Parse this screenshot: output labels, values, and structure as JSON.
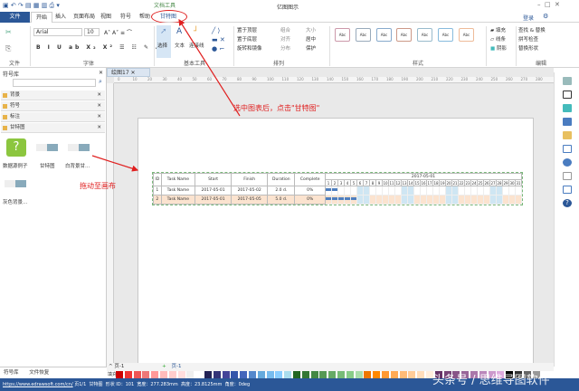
{
  "window": {
    "title": "亿图图示",
    "context_tab_group": "文档工具"
  },
  "tabs": [
    {
      "label": "文件"
    },
    {
      "label": "开始"
    },
    {
      "label": "插入"
    },
    {
      "label": "页面布局"
    },
    {
      "label": "视图"
    },
    {
      "label": "符号"
    },
    {
      "label": "帮助"
    },
    {
      "label": "甘特图"
    }
  ],
  "topright": {
    "login": "登录"
  },
  "ribbon": {
    "font": {
      "name": "Arial",
      "size": "10"
    },
    "groups": [
      "文件",
      "字体",
      "基本工具",
      "排列",
      "样式",
      "编辑"
    ],
    "tools": {
      "select": "选择",
      "text": "文本",
      "connector": "连接线"
    },
    "arrange": [
      "置于顶层",
      "置于底层",
      "旋转和镜像",
      "组合",
      "对齐",
      "分布",
      "大小",
      "居中",
      "保护"
    ],
    "style_sample": "Abc",
    "fill": [
      "填充",
      "线条",
      "阴影"
    ],
    "edit": [
      "查找 & 替换",
      "拼写检查",
      "替换形状"
    ]
  },
  "library": {
    "title": "符号库",
    "items": [
      "背景",
      "符号",
      "标注",
      "甘特图"
    ],
    "shapes": [
      "数据源例子",
      "甘特图",
      "白背景甘...",
      "灰色背景..."
    ]
  },
  "document_tab": "绘图17",
  "ruler_labels": [
    "0",
    "10",
    "20",
    "30",
    "40",
    "50",
    "60",
    "70",
    "80",
    "90",
    "100",
    "110",
    "120",
    "130",
    "140",
    "150",
    "160",
    "170",
    "180",
    "190",
    "200",
    "210",
    "220",
    "230",
    "240",
    "250",
    "260",
    "270",
    "280"
  ],
  "gantt": {
    "headers": [
      "ID",
      "Task Name",
      "Start",
      "Finish",
      "Duration",
      "Complete"
    ],
    "month": "2017-05-01",
    "days": 31,
    "weekend_days": [
      6,
      7,
      13,
      14,
      20,
      21,
      27,
      28
    ],
    "rows": [
      {
        "id": "1",
        "name": "Task Name",
        "start": "2017-05-01",
        "finish": "2017-05-02",
        "duration": "2.0 d.",
        "complete": "0%",
        "bar_days": 2
      },
      {
        "id": "2",
        "name": "Task Name",
        "start": "2017-05-01",
        "finish": "2017-05-05",
        "duration": "5.0 d.",
        "complete": "0%",
        "bar_days": 5
      }
    ]
  },
  "annotations": {
    "click_hint": "选中图表后，点击\"甘特图\"",
    "drag_hint": "拖动至画布"
  },
  "bottom": {
    "panel_tabs": [
      "符号库",
      "文件恢复"
    ],
    "page_tab": "页-1",
    "page_tab2": "页-1",
    "fill_label": "填充"
  },
  "status": {
    "url": "https://www.edrawsoft.com/cn/",
    "page": "页1/1",
    "shape": "甘特图",
    "shape_id": "形状 ID：101",
    "width": "宽度：277.283mm",
    "height": "高度：23.8125mm",
    "angle": "角度：0deg"
  },
  "watermark": "头条号 / 思维导图软件",
  "colors": {
    "accent": "#2b5797",
    "annotation": "#e02020",
    "weekend": "#cfe6f3",
    "row_highlight": "#fbe3cf",
    "bar": "#4f7fbf"
  }
}
